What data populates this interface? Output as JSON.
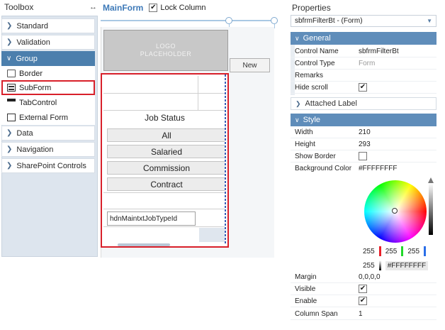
{
  "toolbox": {
    "title": "Toolbox",
    "pin_glyph": "↔",
    "sections": [
      {
        "label": "Standard",
        "active": false
      },
      {
        "label": "Validation",
        "active": false
      },
      {
        "label": "Group",
        "active": true
      },
      {
        "label": "Data",
        "active": false
      },
      {
        "label": "Navigation",
        "active": false
      },
      {
        "label": "SharePoint Controls",
        "active": false
      }
    ],
    "group_items": [
      {
        "label": "Border",
        "icon": "border-icon"
      },
      {
        "label": "SubForm",
        "icon": "subform-icon"
      },
      {
        "label": "TabControl",
        "icon": "tabcontrol-icon"
      },
      {
        "label": "External Form",
        "icon": "external-form-icon"
      }
    ]
  },
  "designer": {
    "title": "MainForm",
    "lock_column_label": "Lock Column",
    "lock_column_checked": true,
    "logo_text_1": "LOGO",
    "logo_text_2": "PLACEHOLDER",
    "new_button": "New",
    "subform": {
      "job_status_label": "Job Status",
      "buttons": [
        "All",
        "Salaried",
        "Commission",
        "Contract"
      ],
      "hidden_field_value": "hdnMaintxtJobTypeId"
    }
  },
  "properties": {
    "title": "Properties",
    "selected_object": "sbfrmFilterBt - (Form)",
    "general": {
      "label": "General",
      "rows": [
        {
          "label": "Control Name",
          "value": "sbfrmFilterBt"
        },
        {
          "label": "Control Type",
          "value": "Form"
        },
        {
          "label": "Remarks",
          "value": ""
        },
        {
          "label": "Hide scroll",
          "value": "✔"
        }
      ]
    },
    "attached_label": "Attached Label",
    "style": {
      "label": "Style",
      "rows": [
        {
          "label": "Width",
          "value": "210"
        },
        {
          "label": "Height",
          "value": "293"
        },
        {
          "label": "Show Border",
          "value": ""
        },
        {
          "label": "Background Color",
          "value": "#FFFFFFFF"
        }
      ]
    },
    "color_picker": {
      "r": "255",
      "g": "255",
      "b": "255",
      "a": "255",
      "hex": "#FFFFFFFF"
    },
    "lower_rows": [
      {
        "label": "Margin",
        "value": "0,0,0,0"
      },
      {
        "label": "Visible",
        "value": "✔"
      },
      {
        "label": "Enable",
        "value": "✔"
      },
      {
        "label": "Column Span",
        "value": "1"
      }
    ]
  },
  "colors": {
    "accent": "#4c7fad",
    "group_header": "#5f8dba",
    "highlight": "#d8202a",
    "designer_title": "#3d79b8"
  }
}
